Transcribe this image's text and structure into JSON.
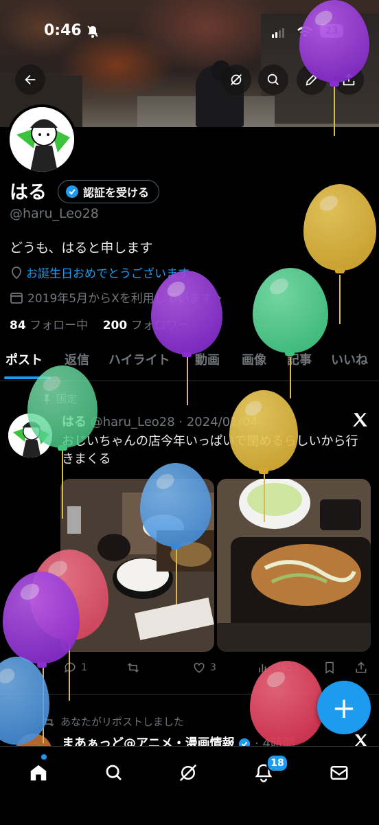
{
  "status_bar": {
    "time": "0:46",
    "battery": "23"
  },
  "profile": {
    "name": "はる",
    "verify_button": "認証を受ける",
    "handle": "@haru_Leo28",
    "bio": "どうも、はると申します",
    "birthday": "お誕生日おめでとうございます",
    "joined": "2019年5月からXを利用しています",
    "following_count": "84",
    "following_label": "フォロー中",
    "followers_count": "200",
    "followers_label": "フォロワー"
  },
  "tabs": [
    "ポスト",
    "返信",
    "ハイライト",
    "動画",
    "画像",
    "記事",
    "いいね"
  ],
  "pinned_post": {
    "pinned_label": "固定",
    "author": "はる",
    "handle_date": "@haru_Leo28 · 2024/01/04",
    "text": "おじいちゃんの店今年いっぱいで閉めるらしいから行きまくる",
    "actions": {
      "replies": "1",
      "retweets": "",
      "likes": "3",
      "views": "4953"
    }
  },
  "second_post": {
    "repost_note": "あなたがリポストしました",
    "author": "まあぁっど@アニメ・漫画情報",
    "time": "· 4時間"
  },
  "bottom_nav": {
    "notifications_badge": "18"
  },
  "fab_label": "+",
  "colors": {
    "accent": "#1d9bf0",
    "muted": "#71767b",
    "background": "#000000"
  },
  "icons": [
    "back-arrow-icon",
    "grok-icon",
    "search-icon",
    "edit-pencil-icon",
    "share-icon",
    "verified-badge-icon",
    "location-pin-icon",
    "calendar-icon",
    "pin-icon",
    "x-logo-icon",
    "reply-icon",
    "retweet-icon",
    "like-icon",
    "views-icon",
    "bookmark-icon",
    "home-icon",
    "notifications-icon",
    "mail-icon"
  ]
}
